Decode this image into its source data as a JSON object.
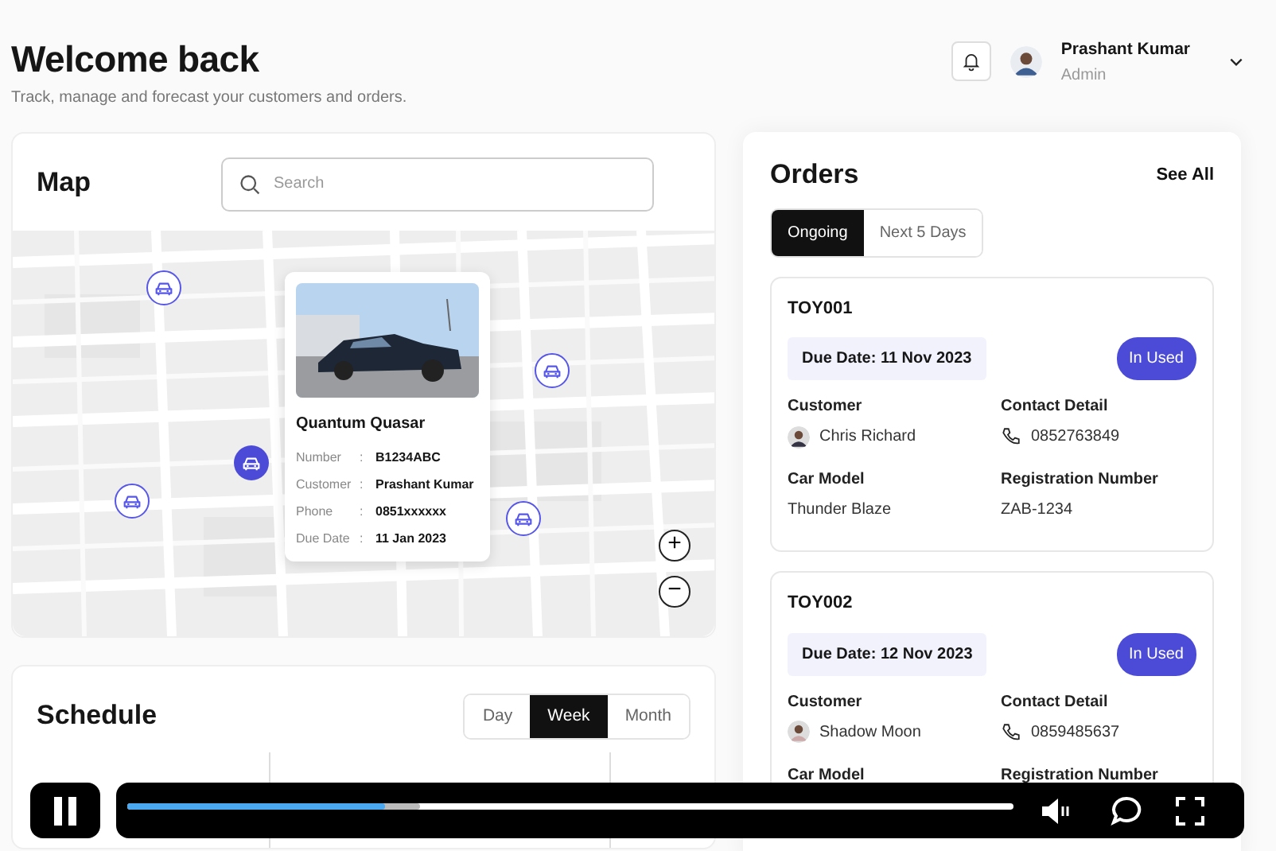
{
  "header": {
    "title": "Welcome back",
    "subtitle": "Track, manage and forecast your customers and orders."
  },
  "user": {
    "name": "Prashant Kumar",
    "role": "Admin"
  },
  "map": {
    "title": "Map",
    "search": {
      "placeholder": "Search"
    },
    "markers": [
      {
        "selected": false
      },
      {
        "selected": true
      },
      {
        "selected": false
      },
      {
        "selected": false
      },
      {
        "selected": false
      }
    ],
    "popup": {
      "title": "Quantum Quasar",
      "separator": ":",
      "rows": [
        {
          "label": "Number",
          "value": "B1234ABC"
        },
        {
          "label": "Customer",
          "value": "Prashant Kumar"
        },
        {
          "label": "Phone",
          "value": "0851xxxxxx"
        },
        {
          "label": "Due Date",
          "value": "11 Jan 2023"
        }
      ]
    },
    "zoom_in": "+",
    "zoom_out": "−"
  },
  "schedule": {
    "title": "Schedule",
    "views": [
      {
        "label": "Day",
        "selected": false
      },
      {
        "label": "Week",
        "selected": true
      },
      {
        "label": "Month",
        "selected": false
      }
    ]
  },
  "orders": {
    "title": "Orders",
    "see_all": "See All",
    "tabs": [
      {
        "label": "Ongoing",
        "selected": true
      },
      {
        "label": "Next 5 Days",
        "selected": false
      }
    ],
    "items": [
      {
        "id": "TOY001",
        "due_date": "Due Date: 11 Nov 2023",
        "status": "In Used",
        "customer_label": "Customer",
        "customer": "Chris Richard",
        "contact_label": "Contact Detail",
        "phone": "0852763849",
        "model_label": "Car Model",
        "model": "Thunder Blaze",
        "reg_label": "Registration Number",
        "reg": "ZAB-1234"
      },
      {
        "id": "TOY002",
        "due_date": "Due Date: 12 Nov 2023",
        "status": "In Used",
        "customer_label": "Customer",
        "customer": "Shadow Moon",
        "contact_label": "Contact Detail",
        "phone": "0859485637",
        "model_label": "Car Model",
        "reg_label": "Registration Number"
      }
    ]
  },
  "video_player": {
    "playing": true,
    "progress": {
      "level": 0.29
    },
    "buffered": {
      "level": 0.33
    }
  }
}
